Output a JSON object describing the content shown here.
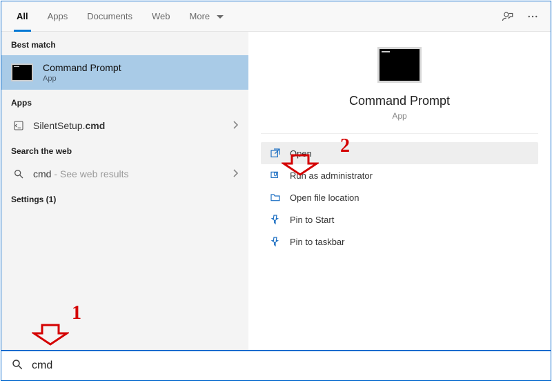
{
  "tabs": {
    "all": "All",
    "apps": "Apps",
    "documents": "Documents",
    "web": "Web",
    "more": "More"
  },
  "left": {
    "best_match_header": "Best match",
    "best_match": {
      "title": "Command Prompt",
      "subtitle": "App"
    },
    "apps_header": "Apps",
    "apps_item_prefix": "SilentSetup.",
    "apps_item_bold": "cmd",
    "web_header": "Search the web",
    "web_query": "cmd",
    "web_suffix": " - See web results",
    "settings_header": "Settings (1)"
  },
  "preview": {
    "title": "Command Prompt",
    "subtitle": "App",
    "actions": {
      "open": "Open",
      "admin": "Run as administrator",
      "file_loc": "Open file location",
      "pin_start": "Pin to Start",
      "pin_taskbar": "Pin to taskbar"
    }
  },
  "search": {
    "value": "cmd"
  },
  "annotations": {
    "one": "1",
    "two": "2"
  }
}
